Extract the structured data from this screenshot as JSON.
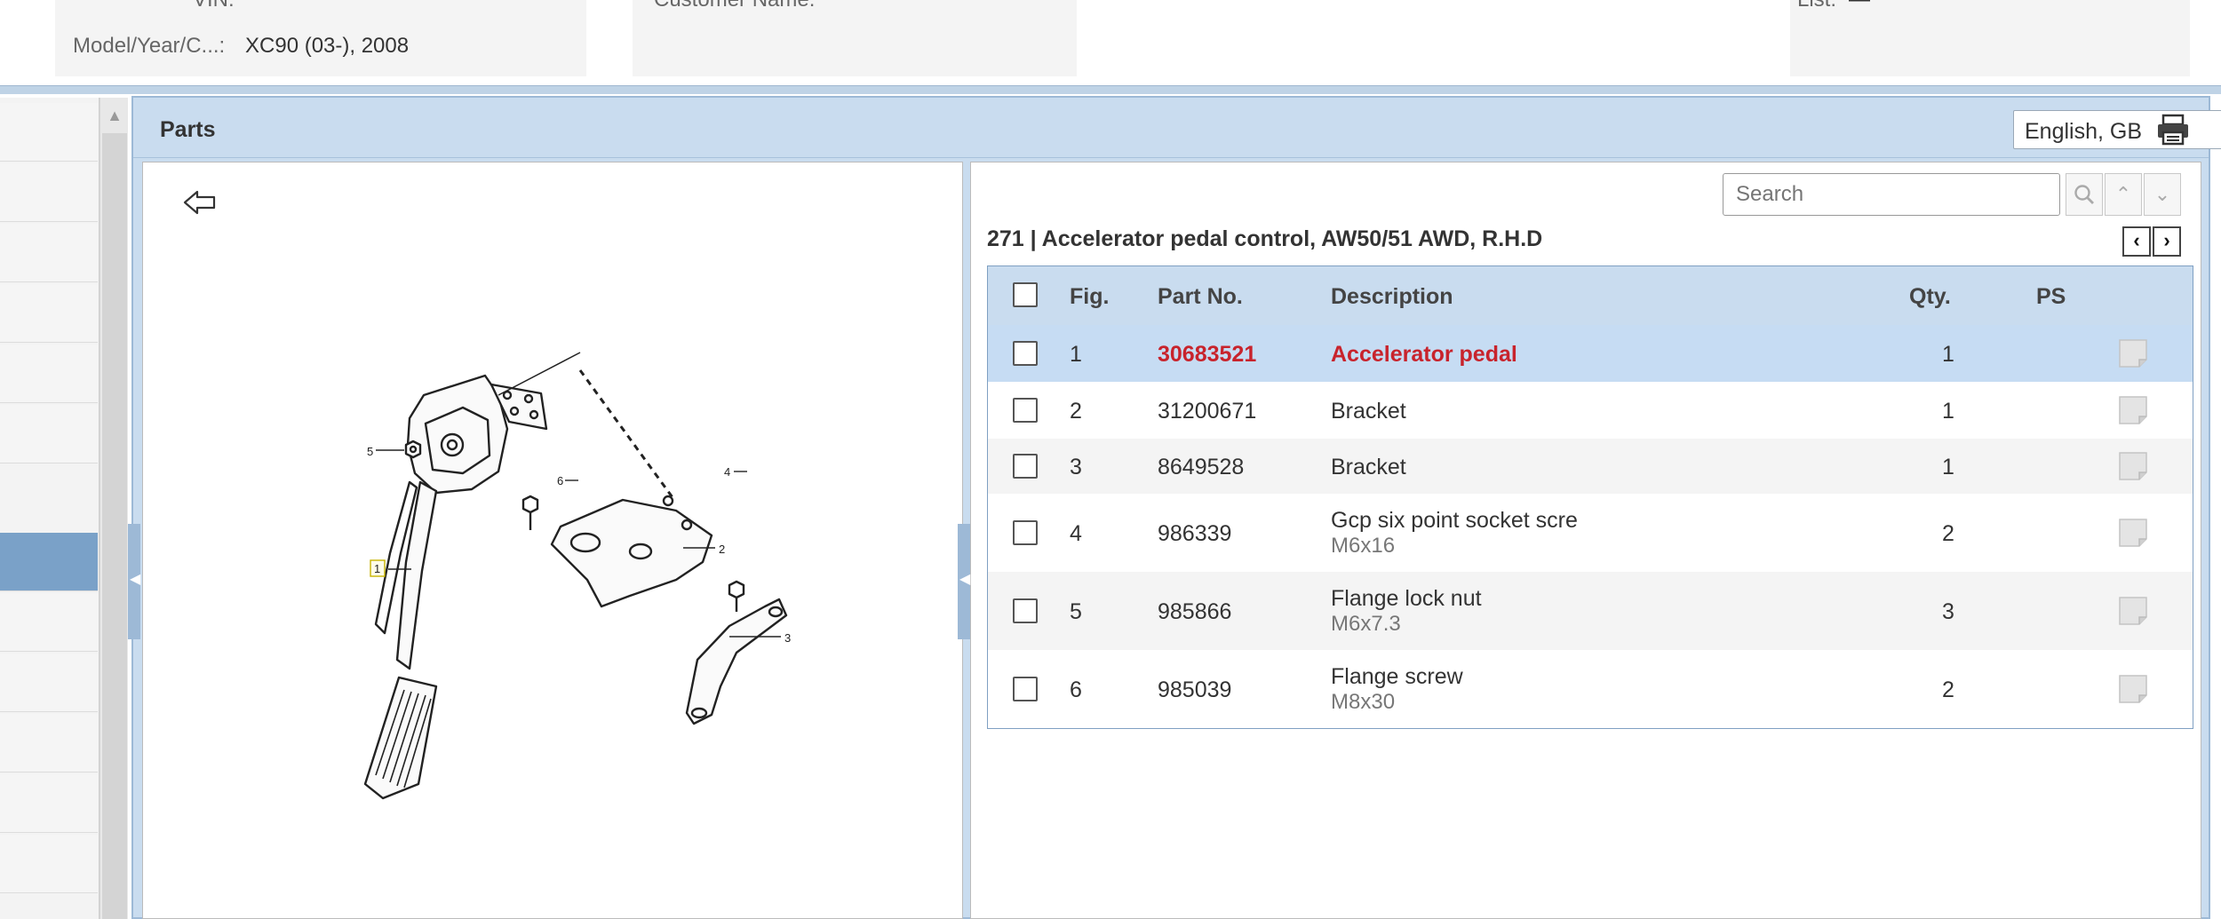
{
  "header": {
    "vin_label": "VIN:",
    "model_label": "Model/Year/C...:",
    "model_value": "XC90 (03-), 2008",
    "customer_label": "Customer Name:",
    "list_label": "List:",
    "list_value": "—"
  },
  "panel": {
    "title": "Parts",
    "language": "English, GB"
  },
  "list": {
    "search_placeholder": "Search",
    "group_title": "271  |  Accelerator pedal control, AW50/51 AWD, R.H.D",
    "columns": {
      "fig": "Fig.",
      "part_no": "Part No.",
      "description": "Description",
      "qty": "Qty.",
      "ps": "PS"
    },
    "rows": [
      {
        "fig": "1",
        "part_no": "30683521",
        "description": "Accelerator pedal",
        "sub": "",
        "qty": "1"
      },
      {
        "fig": "2",
        "part_no": "31200671",
        "description": "Bracket",
        "sub": "",
        "qty": "1"
      },
      {
        "fig": "3",
        "part_no": "8649528",
        "description": "Bracket",
        "sub": "",
        "qty": "1"
      },
      {
        "fig": "4",
        "part_no": "986339",
        "description": "Gcp six point socket scre",
        "sub": "M6x16",
        "qty": "2"
      },
      {
        "fig": "5",
        "part_no": "985866",
        "description": "Flange lock nut",
        "sub": "M6x7.3",
        "qty": "3"
      },
      {
        "fig": "6",
        "part_no": "985039",
        "description": "Flange screw",
        "sub": "M8x30",
        "qty": "2"
      }
    ]
  },
  "diagram": {
    "callouts": [
      "1",
      "2",
      "3",
      "4",
      "5",
      "6"
    ]
  },
  "colors": {
    "panel_blue": "#c9dcef",
    "selected_row": "#c6dcf3",
    "highlight_red": "#c8232c",
    "nav_active": "#7aa1c8"
  }
}
